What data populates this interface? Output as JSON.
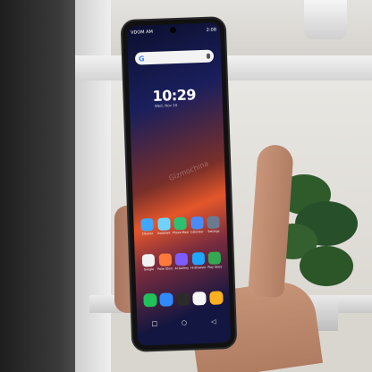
{
  "status_bar": {
    "left_text": "VDOM AM",
    "battery_text": "2:08"
  },
  "search_bar": {
    "logo": "G",
    "icon": "mic-icon"
  },
  "clock": {
    "time": "10:29",
    "date": "Wed, Nov 10"
  },
  "watermark": "Gizmochina",
  "apps_row1": [
    {
      "label": "Cleaner",
      "color": "#3fa7ff"
    },
    {
      "label": "Assistant",
      "color": "#6fd3ff"
    },
    {
      "label": "Phone Master",
      "color": "#2fbf71"
    },
    {
      "label": "Calendar",
      "color": "#4a8cff"
    },
    {
      "label": "Settings",
      "color": "#6b7a8f"
    }
  ],
  "apps_row2": [
    {
      "label": "Google",
      "color": "#f2f2f2"
    },
    {
      "label": "Palm Store",
      "color": "#ff7a3a"
    },
    {
      "label": "AI Gallery",
      "color": "#7c5cff"
    },
    {
      "label": "Hi Browser",
      "color": "#1fa6ff"
    },
    {
      "label": "Play Store",
      "color": "#34a853"
    }
  ],
  "dock": [
    {
      "label": "Phone",
      "color": "#20c05a"
    },
    {
      "label": "Messages",
      "color": "#2e8bff"
    },
    {
      "label": "Camera",
      "color": "#2b2b2b"
    },
    {
      "label": "Chrome",
      "color": "#f5f5f5"
    },
    {
      "label": "Photos",
      "color": "#ffb020"
    }
  ],
  "nav": {
    "back": "◁",
    "home": "○",
    "recent": "□"
  }
}
